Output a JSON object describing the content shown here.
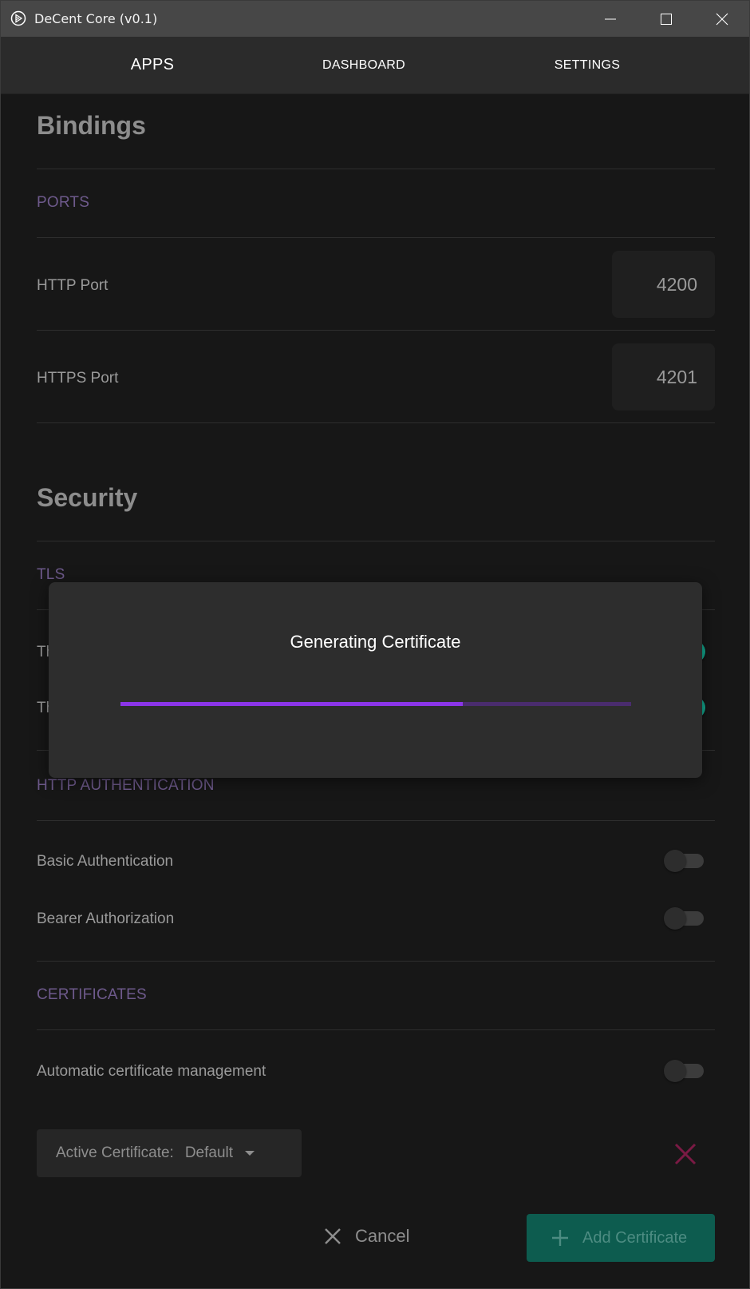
{
  "window": {
    "title": "DeCent Core (v0.1)"
  },
  "nav": {
    "apps": "APPS",
    "dashboard": "DASHBOARD",
    "settings": "SETTINGS"
  },
  "bindings": {
    "title": "Bindings",
    "ports_header": "PORTS",
    "http_port_label": "HTTP Port",
    "http_port_value": "4200",
    "https_port_label": "HTTPS Port",
    "https_port_value": "4201"
  },
  "security": {
    "title": "Security",
    "tls_header": "TLS",
    "tls_row1_label_visible": "Th",
    "tls_row1_enabled": true,
    "tls_row2_label_visible": "Th",
    "tls_row2_enabled": true,
    "http_auth_header": "HTTP AUTHENTICATION",
    "basic_auth_label": "Basic Authentication",
    "basic_auth_enabled": false,
    "bearer_label": "Bearer Authorization",
    "bearer_enabled": false,
    "certificates_header": "CERTIFICATES",
    "auto_cert_label": "Automatic certificate management",
    "auto_cert_enabled": false,
    "active_cert_label": "Active Certificate:",
    "active_cert_value": "Default"
  },
  "actions": {
    "cancel": "Cancel",
    "add_certificate": "Add Certificate"
  },
  "modal": {
    "title": "Generating Certificate",
    "progress": 0.67
  },
  "colors": {
    "accent_purple": "#8b35e8",
    "header_purple": "#6e5a8c",
    "toggle_on": "#12a98f",
    "add_button": "#0d5c4f",
    "remove_icon": "#7a1a44"
  },
  "icons": {
    "app": "decent-logo-icon",
    "minimize": "minimize-icon",
    "maximize": "maximize-icon",
    "close": "close-icon",
    "dropdown": "caret-down-icon",
    "remove": "remove-x-icon",
    "cancel": "close-icon",
    "add": "plus-icon"
  }
}
